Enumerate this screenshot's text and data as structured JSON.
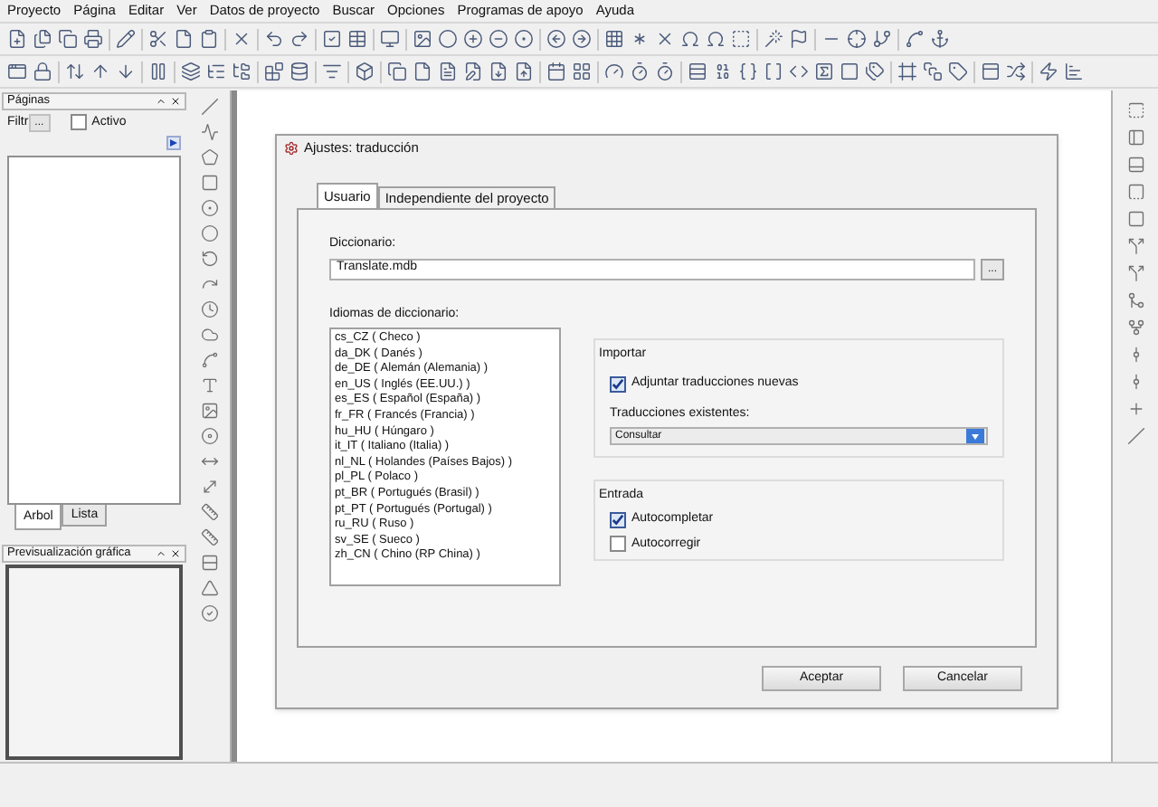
{
  "menu": [
    "Proyecto",
    "Página",
    "Editar",
    "Ver",
    "Datos de proyecto",
    "Buscar",
    "Opciones",
    "Programas de apoyo",
    "Ayuda"
  ],
  "pages_pane": {
    "title": "Páginas",
    "filter_label": "Filtr",
    "filter_button": "...",
    "active": {
      "label": "Activo",
      "checked": false
    },
    "tabs": [
      {
        "label": "Arbol",
        "selected": true
      },
      {
        "label": "Lista",
        "selected": false
      }
    ]
  },
  "preview_pane": {
    "title": "Previsualización gráfica"
  },
  "dialog": {
    "title": "Ajustes: traducción",
    "tabs": [
      {
        "label": "Usuario",
        "selected": true
      },
      {
        "label": "Independiente del proyecto",
        "selected": false
      }
    ],
    "dictionary": {
      "label": "Diccionario:",
      "value": "Translate.mdb",
      "browse": "..."
    },
    "languages": {
      "label": "Idiomas de diccionario:",
      "items": [
        "cs_CZ ( Checo )",
        "da_DK ( Danés )",
        "de_DE ( Alemán (Alemania) )",
        "en_US ( Inglés (EE.UU.) )",
        "es_ES ( Español (España) )",
        "fr_FR ( Francés (Francia) )",
        "hu_HU ( Húngaro )",
        "it_IT ( Italiano (Italia) )",
        "nl_NL ( Holandes (Países Bajos) )",
        "pl_PL ( Polaco )",
        "pt_BR ( Portugués (Brasil) )",
        "pt_PT ( Portugués (Portugal) )",
        "ru_RU ( Ruso )",
        "sv_SE ( Sueco )",
        "zh_CN ( Chino (RP China) )"
      ]
    },
    "import": {
      "title": "Importar",
      "checkbox": {
        "label": "Adjuntar traducciones nuevas",
        "checked": true
      },
      "existing_label": "Traducciones existentes:",
      "existing_value": "Consultar"
    },
    "entry": {
      "title": "Entrada",
      "checkboxes": [
        {
          "label": "Autocompletar",
          "checked": true
        },
        {
          "label": "Autocorregir",
          "checked": false
        }
      ]
    },
    "buttons": [
      "Aceptar",
      "Cancelar"
    ]
  }
}
